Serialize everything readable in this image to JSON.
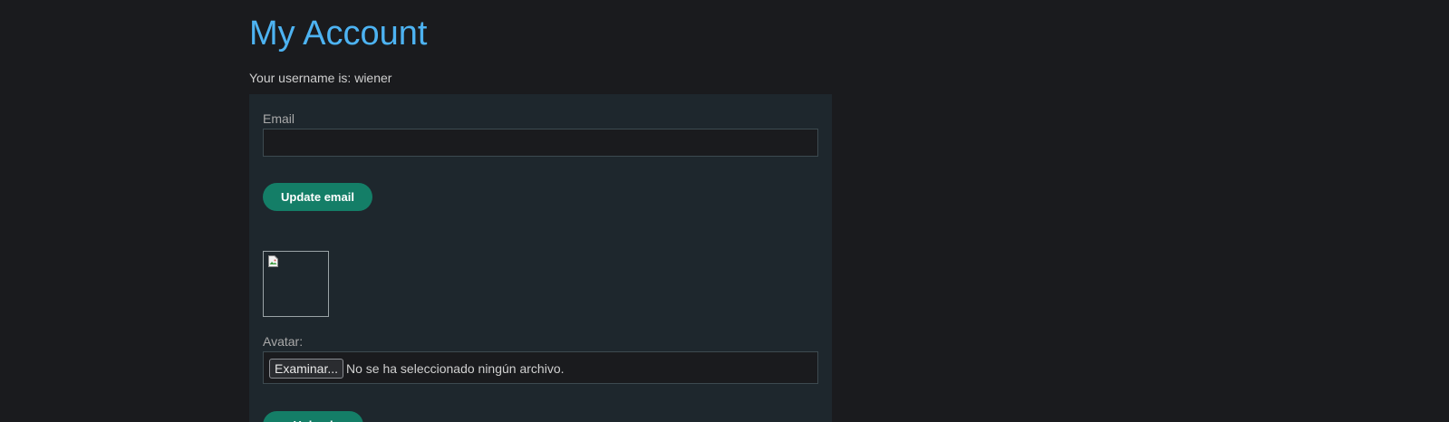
{
  "page": {
    "title": "My Account",
    "username_line": "Your username is: wiener"
  },
  "email_form": {
    "label": "Email",
    "value": "",
    "placeholder": "",
    "submit_label": "Update email"
  },
  "avatar_form": {
    "preview_icon": "broken-image-icon",
    "label": "Avatar:",
    "browse_label": "Examinar...",
    "file_status": "No se ha seleccionado ningún archivo.",
    "submit_label": "Upload"
  },
  "colors": {
    "background": "#1a1b1e",
    "panel": "#1e272d",
    "title": "#4db3f2",
    "button": "#147e67"
  }
}
